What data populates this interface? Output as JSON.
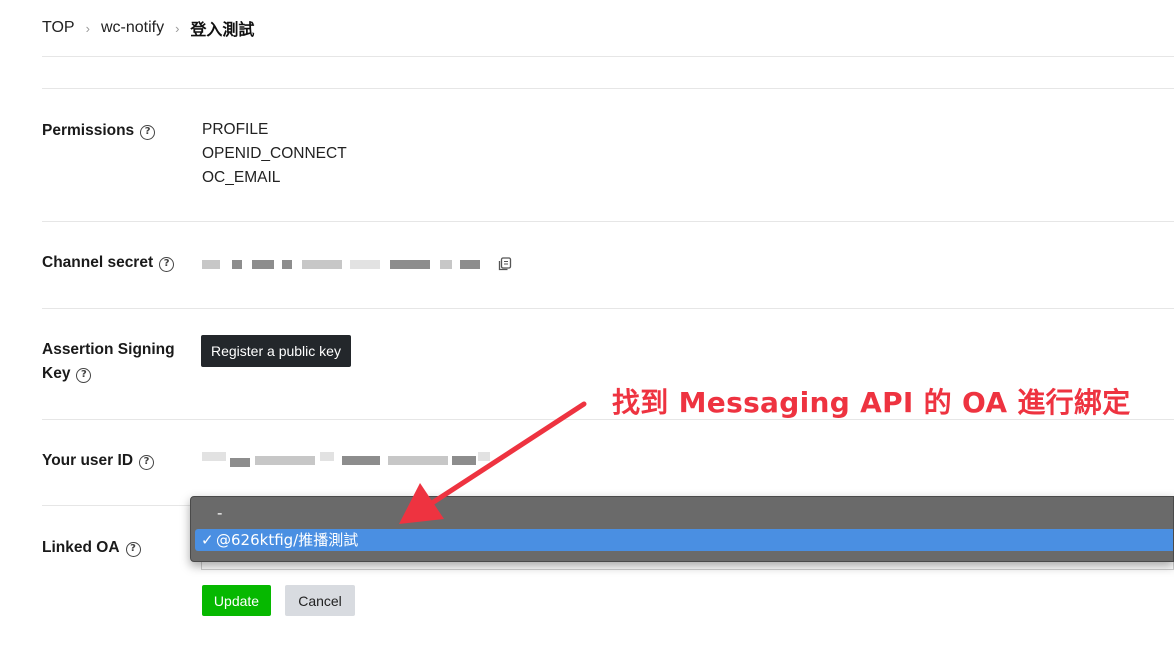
{
  "breadcrumb": {
    "items": [
      "TOP",
      "wc-notify"
    ],
    "current": "登入測試"
  },
  "permissions": {
    "label": "Permissions",
    "values": [
      "PROFILE",
      "OPENID_CONNECT",
      "OC_EMAIL"
    ]
  },
  "channel_secret": {
    "label": "Channel secret"
  },
  "assertion": {
    "label_line1": "Assertion Signing",
    "label_line2": "Key",
    "button": "Register a public key"
  },
  "user_id": {
    "label": "Your user ID"
  },
  "linked_oa": {
    "label": "Linked OA",
    "options": [
      "-",
      "@626ktfig/推播測試"
    ],
    "selected_mark": "✓"
  },
  "actions": {
    "update": "Update",
    "cancel": "Cancel"
  },
  "annotation": {
    "text": "找到 Messaging API 的 OA 進行綁定",
    "color": "#ee3340"
  },
  "icons": {
    "help": "?",
    "breadcrumb_separator": "›"
  },
  "colors": {
    "update_button": "#06b800",
    "selected_option": "#4a8fe2",
    "dark_button": "#23272b"
  }
}
